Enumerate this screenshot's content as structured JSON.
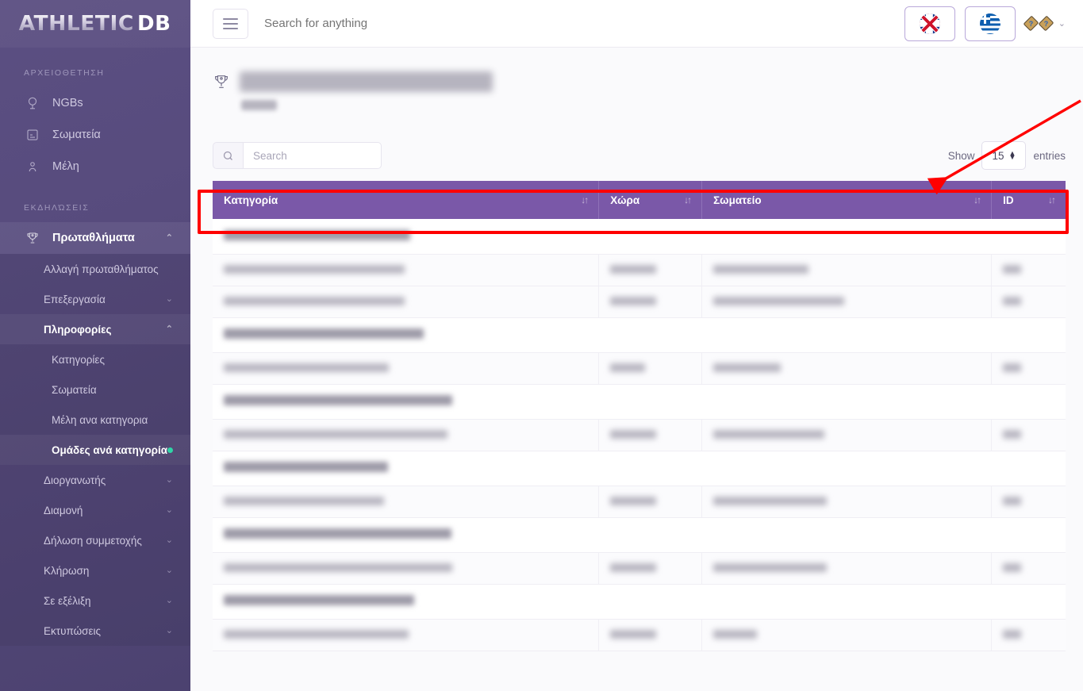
{
  "brand": {
    "part1": "ATHLETIC",
    "part2": "DB"
  },
  "topbar": {
    "menu_icon": "hamburger-icon",
    "search_placeholder": "Search for anything",
    "lang_en": "flag-uk-icon",
    "lang_gr": "flag-greece-icon",
    "user_glyph_1": "?",
    "user_glyph_2": "?",
    "user_chevron": "⌄"
  },
  "sidebar": {
    "sections": [
      {
        "label": "ΑΡΧΕΙΟΘΕΤΗΣΗ",
        "items": [
          {
            "label": "NGBs",
            "icon": "globe-icon",
            "chevron": ""
          },
          {
            "label": "Σωματεία",
            "icon": "building-icon",
            "chevron": ""
          },
          {
            "label": "Μέλη",
            "icon": "user-pin-icon",
            "chevron": ""
          }
        ]
      },
      {
        "label": "ΕΚΔΗΛΏΣΕΙΣ",
        "items": [
          {
            "label": "Πρωταθλήματα",
            "icon": "trophy-icon",
            "chevron": "⌃",
            "active": true
          }
        ]
      }
    ],
    "sub_items": [
      {
        "label": "Αλλαγή πρωταθλήματος",
        "chevron": ""
      },
      {
        "label": "Επεξεργασία",
        "chevron": "⌄"
      },
      {
        "label": "Πληροφορίες",
        "chevron": "⌃",
        "open": true
      }
    ],
    "sub_sub_items": [
      {
        "label": "Κατηγορίες",
        "selected": false
      },
      {
        "label": "Σωματεία",
        "selected": false
      },
      {
        "label": "Μέλη ανα κατηγορια",
        "selected": false
      },
      {
        "label": "Ομάδες ανά κατηγορία",
        "selected": true
      }
    ],
    "tail_items": [
      {
        "label": "Διοργανωτής",
        "chevron": "⌄"
      },
      {
        "label": "Διαμονή",
        "chevron": "⌄"
      },
      {
        "label": "Δήλωση συμμετοχής",
        "chevron": "⌄"
      },
      {
        "label": "Κλήρωση",
        "chevron": "⌄"
      },
      {
        "label": "Σε εξέλιξη",
        "chevron": "⌄"
      },
      {
        "label": "Εκτυπώσεις",
        "chevron": "⌄"
      }
    ]
  },
  "page": {
    "title_redacted": "Mens Combat Challenge 2024",
    "subtitle_redacted": "Masters"
  },
  "controls": {
    "search_placeholder": "Search",
    "search_value": "",
    "show_label": "Show",
    "entries_label": "entries",
    "page_size": "15"
  },
  "table": {
    "columns": [
      {
        "label": "Κατηγορία",
        "sort_icon": "↓↑"
      },
      {
        "label": "Χώρα",
        "sort_icon": "↓↑"
      },
      {
        "label": "Σωματείο",
        "sort_icon": "↓↑"
      },
      {
        "label": "ID",
        "sort_icon": "↓↑"
      }
    ],
    "rows": [
      {
        "type": "group",
        "category_w": 235
      },
      {
        "type": "data",
        "category_w": 228,
        "country_w": 58,
        "club_w": 120,
        "id_w": 23
      },
      {
        "type": "data",
        "category_w": 228,
        "country_w": 58,
        "club_w": 165,
        "id_w": 23
      },
      {
        "type": "group",
        "category_w": 252
      },
      {
        "type": "data",
        "category_w": 208,
        "country_w": 44,
        "club_w": 85,
        "id_w": 23
      },
      {
        "type": "group",
        "category_w": 288
      },
      {
        "type": "data",
        "category_w": 282,
        "country_w": 58,
        "club_w": 140,
        "id_w": 23
      },
      {
        "type": "group",
        "category_w": 207
      },
      {
        "type": "data",
        "category_w": 202,
        "country_w": 58,
        "club_w": 143,
        "id_w": 23
      },
      {
        "type": "group",
        "category_w": 287
      },
      {
        "type": "data",
        "category_w": 288,
        "country_w": 58,
        "club_w": 143,
        "id_w": 23
      },
      {
        "type": "group",
        "category_w": 240
      },
      {
        "type": "data",
        "category_w": 233,
        "country_w": 58,
        "club_w": 55,
        "id_w": 23
      }
    ]
  },
  "annotations": {
    "highlight_color": "#ff0000",
    "shapes": [
      "rectangle-around-table-header",
      "arrow-pointing-to-table-header"
    ]
  }
}
